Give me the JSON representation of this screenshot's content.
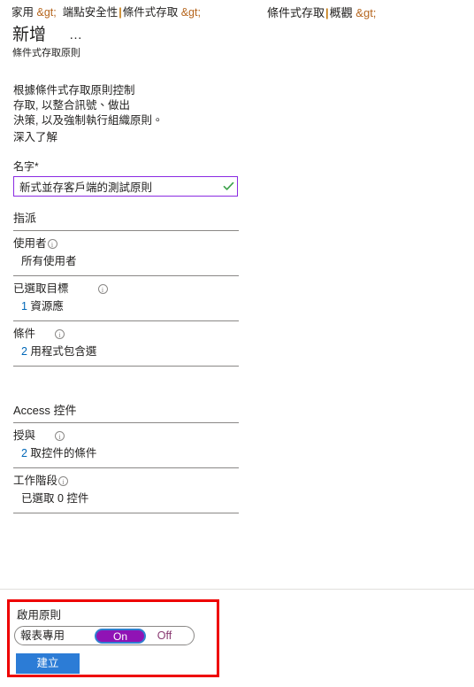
{
  "breadcrumb": {
    "left_part1": "家用",
    "left_sep1": "&gt;",
    "left_part2": "端點安全性",
    "left_bar": "|",
    "left_part3": "條件式存取",
    "left_sep2": "&gt;",
    "right_part1": "條件式存取",
    "right_bar": "|",
    "right_part2": "概觀",
    "right_sep": "&gt;"
  },
  "header": {
    "title": "新增",
    "more_menu": "…",
    "subtitle": "條件式存取原則"
  },
  "description": {
    "line1": "根據條件式存取原則控制",
    "line2": "存取, 以整合訊號、做出",
    "line3": "決策, 以及強制執行組織原則。",
    "learn_more": "深入了解"
  },
  "name_field": {
    "label": "名字",
    "required_marker": "*",
    "value": "新式並存客戶端的測試原則",
    "placeholder": "名字",
    "validation_icon": "check-icon",
    "border_color": "#8a2be2",
    "check_color": "#3fa34d"
  },
  "assignments": {
    "section_title": "指派",
    "rows": [
      {
        "label": "使用者",
        "info_icon": "info-icon",
        "value_num": "",
        "value_text": "所有使用者",
        "gap": "small"
      },
      {
        "label": "已選取目標",
        "info_icon": "info-icon",
        "value_num": "1",
        "value_text": " 資源應",
        "gap": "large"
      },
      {
        "label": "條件",
        "info_icon": "info-icon",
        "value_num": "2",
        "value_text": " 用程式包含選",
        "gap": "medium"
      }
    ]
  },
  "access_controls": {
    "section_title": "Access 控件",
    "rows": [
      {
        "label": "授與",
        "info_icon": "info-icon",
        "value_num": "2",
        "value_text": " 取控件的條件",
        "gap": "medium"
      },
      {
        "label": "工作階段",
        "info_icon": "info-icon",
        "value_num": "",
        "value_text": "已選取 0 控件",
        "gap": "small"
      }
    ]
  },
  "footer": {
    "enable_label": "啟用原則",
    "toggle": {
      "report_only": "報表專用",
      "on": "On",
      "off": "Off",
      "selected": "On",
      "on_color": "#9013b5",
      "focus_ring_color": "#2f7fd0"
    },
    "create_button": "建立",
    "create_button_color": "#2c7cd6",
    "highlight_color": "#ee0000"
  }
}
